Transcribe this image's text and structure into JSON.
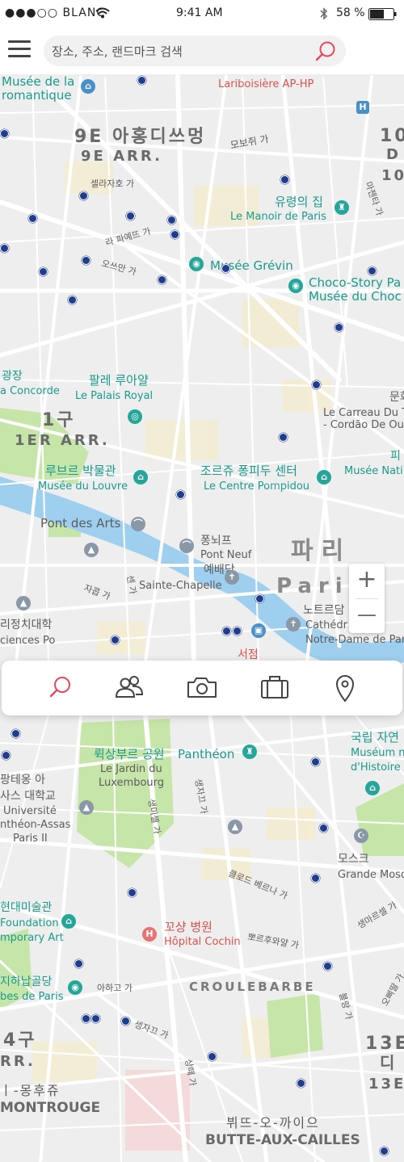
{
  "status_bar": {
    "carrier": "●●●○○ BLANC",
    "time": "9:41 AM",
    "battery": "58 %"
  },
  "search": {
    "placeholder": "장소, 주소, 랜드마크 검색"
  },
  "zoom": {
    "in": "+",
    "out": "—"
  },
  "tabs": [
    "search",
    "people",
    "camera",
    "briefcase",
    "location"
  ],
  "colors": {
    "accent": "#e8475f",
    "water": "#9fcfee",
    "park": "#c6e5a8",
    "road": "#ffffff",
    "land": "#eeeeee"
  },
  "map_labels": {
    "musee_romantique_1": "Musée de la",
    "musee_romantique_2": "romantique",
    "lariboisiere": "Lariboisière AP-HP",
    "arr9_kr": "9E 아홍디쓰멍",
    "arr9_fr": "9E ARR.",
    "arr10_kr": "10",
    "arr10_a": "D",
    "arr10_b": "10",
    "street_mobeuju": "모보쥐 가",
    "street_selajaja": "셀라자호 가",
    "yoomyung": "유령의 집",
    "manoir": "Le Manoir de Paris",
    "street_mazeunta": "마젠타 가",
    "street_lafayette": "라 파예뜨 가",
    "street_osseuman": "오쓰만 가",
    "grevin": "Musée Grévin",
    "chocostory_1": "Choco-Story Pa",
    "chocostory_2": "Musée du Choc",
    "gwangjang": "광장",
    "concorde": "a Concorde",
    "palais_kr": "팔레 루아얄",
    "palais_fr": "Le Palais Royal",
    "munhwa": "문화",
    "carreau_1": "Le Carreau Du T",
    "carreau_2": "- Cordão De Our",
    "arr1_kr": "1구",
    "arr1_fr": "1ER ARR.",
    "louvre_kr": "루브르 박물관",
    "louvre_fr": "Musée du Louvre",
    "pompidou_kr": "조르쥬 퐁피두 센터",
    "pompidou_fr": "Le Centre Pompidou",
    "pi": "피",
    "musee_nat": "Musée Nati",
    "pont_arts": "Pont des Arts",
    "pontneuf_kr": "퐁뇌프",
    "pontneuf_fr": "Pont Neuf",
    "paris_kr": "파리",
    "paris_fr": "Paris",
    "chapelle_kr": "예배당",
    "chapelle_fr": "Sainte-Chapelle",
    "street_jakob": "자콥 가",
    "street_sen": "센 가",
    "notredame_kr": "노트르담",
    "notredame_1": "Cathédr",
    "notredame_2": "Notre-Dame de Par",
    "sciencespo_kr": "리정치대학",
    "sciencespo_fr": "ciences Po",
    "seojeom": "서점",
    "national_kr": "국립 자연",
    "national_1": "Muséum n",
    "national_2": "d'Histoire",
    "luxembourg_kr": "뤽상부르 공원",
    "luxembourg_1": "Le Jardin du",
    "luxembourg_2": "Luxembourg",
    "pantheon": "Panthéon",
    "assas_kr_1": "팡테옹 아",
    "assas_kr_2": "사스 대학교",
    "assas_1": "Université",
    "assas_2": "nthéon-Assas",
    "assas_3": "Paris II",
    "street_saintmichel": "생미셸 가",
    "street_saintjacques": "생자끄 가",
    "street_gobelins": "고블랭 가",
    "street_bernard": "클로드 베르나 가",
    "mosque_kr": "모스크",
    "mosque_fr": "Grande Mosq",
    "street_marcel": "생마르셀 가",
    "modern_kr": "현대미술관",
    "modern_1": "Foundation",
    "modern_2": "mporary Art",
    "cochin_kr": "꼬샹 병원",
    "cochin_fr": "Hôpital Cochin",
    "street_bobroyal": "뽀르후와얄 가",
    "street_arago": "아하고 가",
    "catacombs_kr": "지하납골당",
    "catacombs_fr": "bes de Paris",
    "croulebarbe": "CROULEBARBE",
    "arr14_kr": "4구",
    "arr14_fr": "RR.",
    "montrouge_kr": "ㅣ-몽후쥬",
    "montrouge_fr": "MONTROUGE",
    "street_santee": "상떼 가",
    "street_sejakk": "셍자끄 가",
    "street_bobgo": "오삐딸 가",
    "street_bla": "블랑 가",
    "arr13_kr": "13E",
    "arr13_a": "디",
    "arr13_fr": "13E",
    "butte_kr": "뷔뜨-오-까이으",
    "butte_fr": "BUTTE-AUX-CAILLES"
  }
}
